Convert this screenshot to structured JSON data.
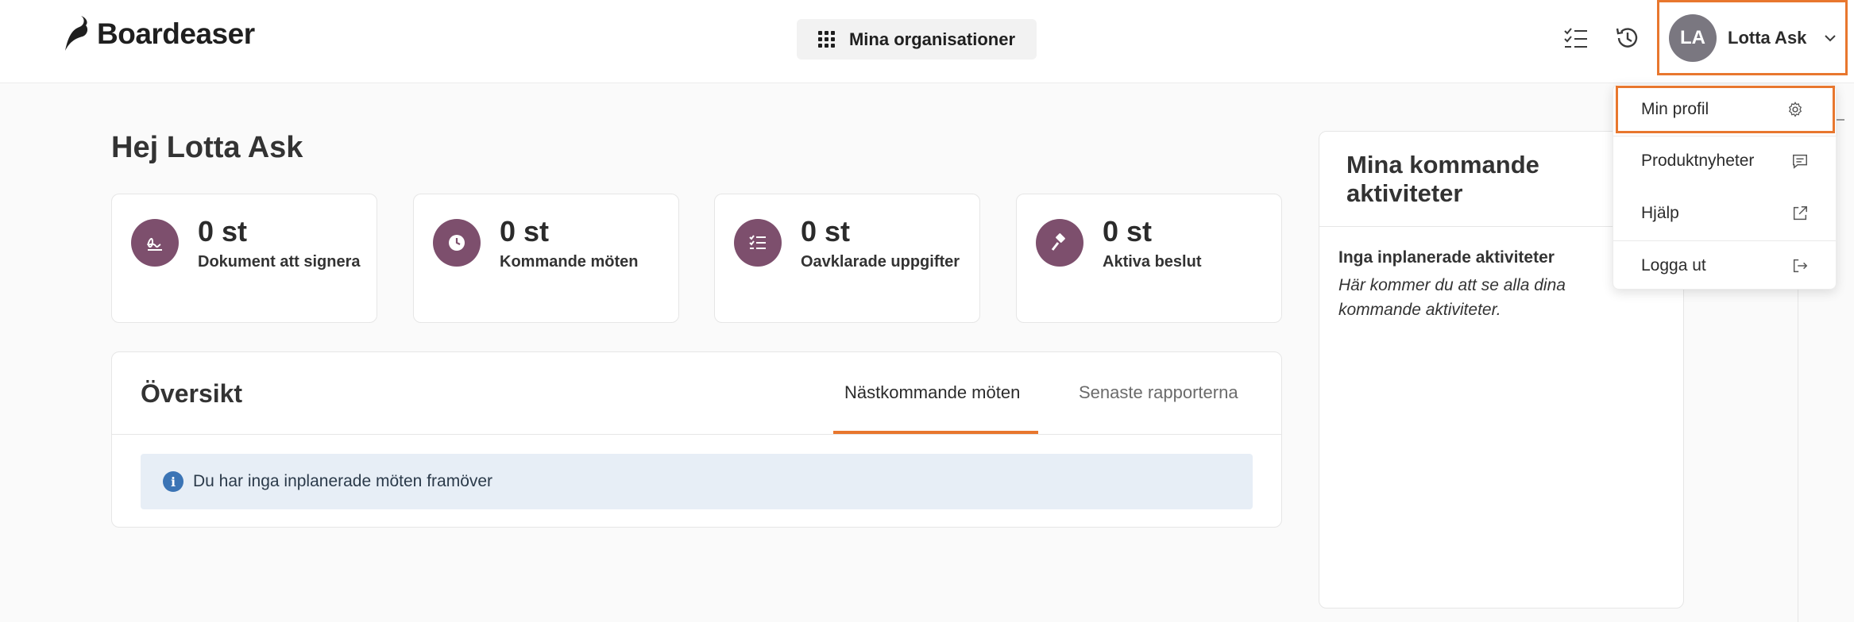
{
  "header": {
    "logo_text": "Boardeaser",
    "org_button_label": "Mina organisationer",
    "user": {
      "initials": "LA",
      "name": "Lotta Ask"
    },
    "icons": [
      "checklist-icon",
      "history-icon"
    ]
  },
  "main": {
    "greeting": "Hej Lotta Ask",
    "stats": [
      {
        "value": "0 st",
        "label": "Dokument att signera",
        "icon": "signature-icon"
      },
      {
        "value": "0 st",
        "label": "Kommande möten",
        "icon": "clock-icon"
      },
      {
        "value": "0 st",
        "label": "Oavklarade uppgifter",
        "icon": "checklist-icon"
      },
      {
        "value": "0 st",
        "label": "Aktiva beslut",
        "icon": "gavel-icon"
      }
    ],
    "overview": {
      "title": "Översikt",
      "tabs": [
        {
          "label": "Nästkommande möten",
          "active": true
        },
        {
          "label": "Senaste rapporterna",
          "active": false
        }
      ],
      "info_message": "Du har inga inplanerade möten framöver"
    },
    "activities": {
      "title": "Mina kommande aktiviteter",
      "empty_title": "Inga inplanerade aktiviteter",
      "empty_text": "Här kommer du att se alla dina kommande aktiviteter."
    }
  },
  "user_menu": {
    "items": [
      {
        "label": "Min profil",
        "icon": "gear-icon"
      },
      {
        "label": "Produktnyheter",
        "icon": "message-icon"
      },
      {
        "label": "Hjälp",
        "icon": "external-link-icon"
      },
      {
        "label": "Logga ut",
        "icon": "logout-icon"
      }
    ]
  },
  "colors": {
    "accent": "#e8772e",
    "stat_icon_bg": "#7d4f6d",
    "info_bg": "#e7eef6",
    "info_icon": "#3b74b5"
  }
}
